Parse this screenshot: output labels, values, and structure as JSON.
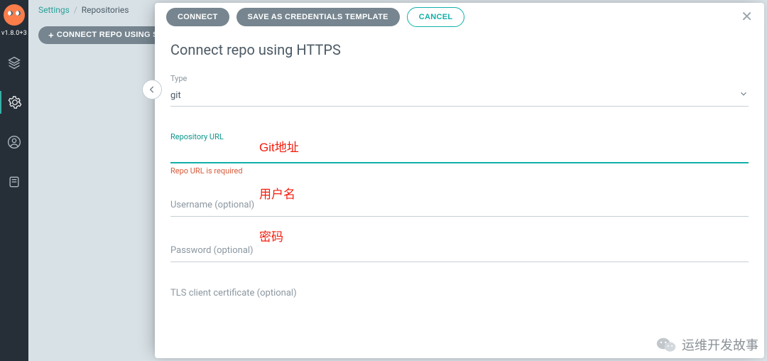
{
  "app": {
    "version": "v1.8.0+3"
  },
  "breadcrumb": {
    "settings": "Settings",
    "repositories": "Repositories"
  },
  "bg_toolbar": {
    "connect_ssh": "CONNECT REPO USING SSH"
  },
  "panel": {
    "buttons": {
      "connect": "CONNECT",
      "save_template": "SAVE AS CREDENTIALS TEMPLATE",
      "cancel": "CANCEL"
    },
    "title": "Connect repo using HTTPS",
    "type": {
      "label": "Type",
      "value": "git"
    },
    "repo_url": {
      "label": "Repository URL",
      "value": "",
      "error": "Repo URL is required"
    },
    "username": {
      "label": "Username (optional)"
    },
    "password": {
      "label": "Password (optional)"
    },
    "tls": {
      "label": "TLS client certificate (optional)"
    }
  },
  "annotations": {
    "git": "Git地址",
    "user": "用户名",
    "pass": "密码"
  },
  "watermark": {
    "text": "运维开发故事"
  }
}
